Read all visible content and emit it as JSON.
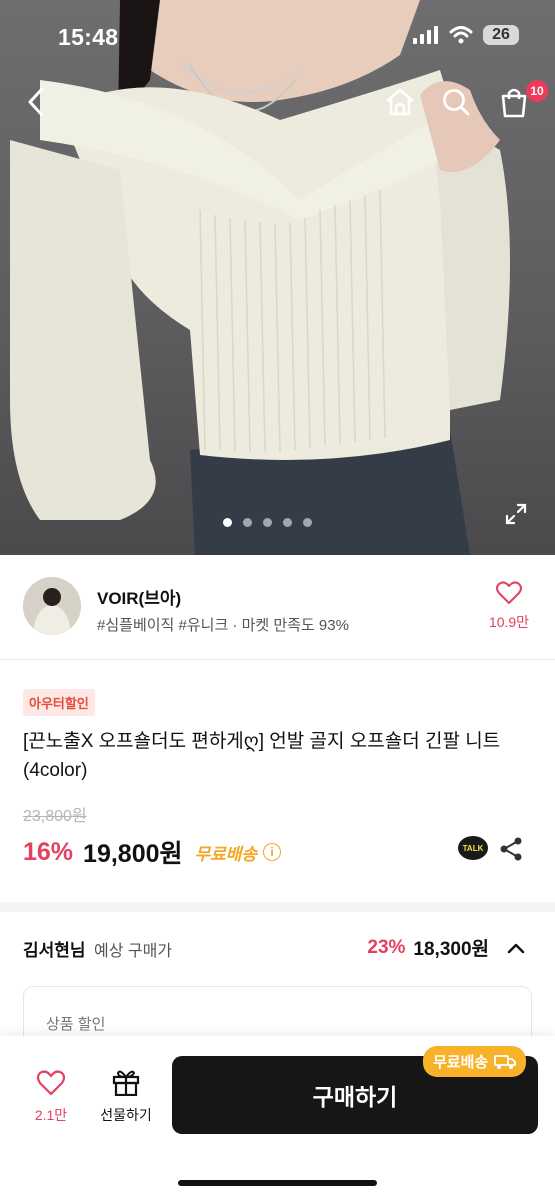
{
  "status_bar": {
    "time": "15:48",
    "battery": "26"
  },
  "header": {
    "back_icon": "chevron-left-icon",
    "home_icon": "home-icon",
    "search_icon": "search-icon",
    "cart_icon": "shopping-bag-icon",
    "cart_count": "10"
  },
  "gallery": {
    "current_index": 1,
    "total": 5
  },
  "seller": {
    "name": "VOIR(브아)",
    "tags": "#심플베이직 #유니크 · 마켓 만족도 93%",
    "like_count": "10.9만"
  },
  "product": {
    "badge": "아우터할인",
    "title": "[끈노출X 오프숄더도 편하게ღ] 언발 골지 오프숄더 긴팔 니트 (4color)",
    "original_price": "23,800원",
    "discount": "16%",
    "price": "19,800원",
    "shipping": "무료배송"
  },
  "expected": {
    "user": "김서현님",
    "label": "예상 구매가",
    "discount": "23%",
    "price": "18,300원"
  },
  "discount_section": {
    "label": "상품 할인"
  },
  "bottom_bar": {
    "like_count": "2.1만",
    "gift_label": "선물하기",
    "buy_label": "구매하기",
    "ship_pill": "무료배송"
  },
  "colors": {
    "accent": "#e4405f",
    "shipping": "#f5a623",
    "button": "#161616"
  }
}
